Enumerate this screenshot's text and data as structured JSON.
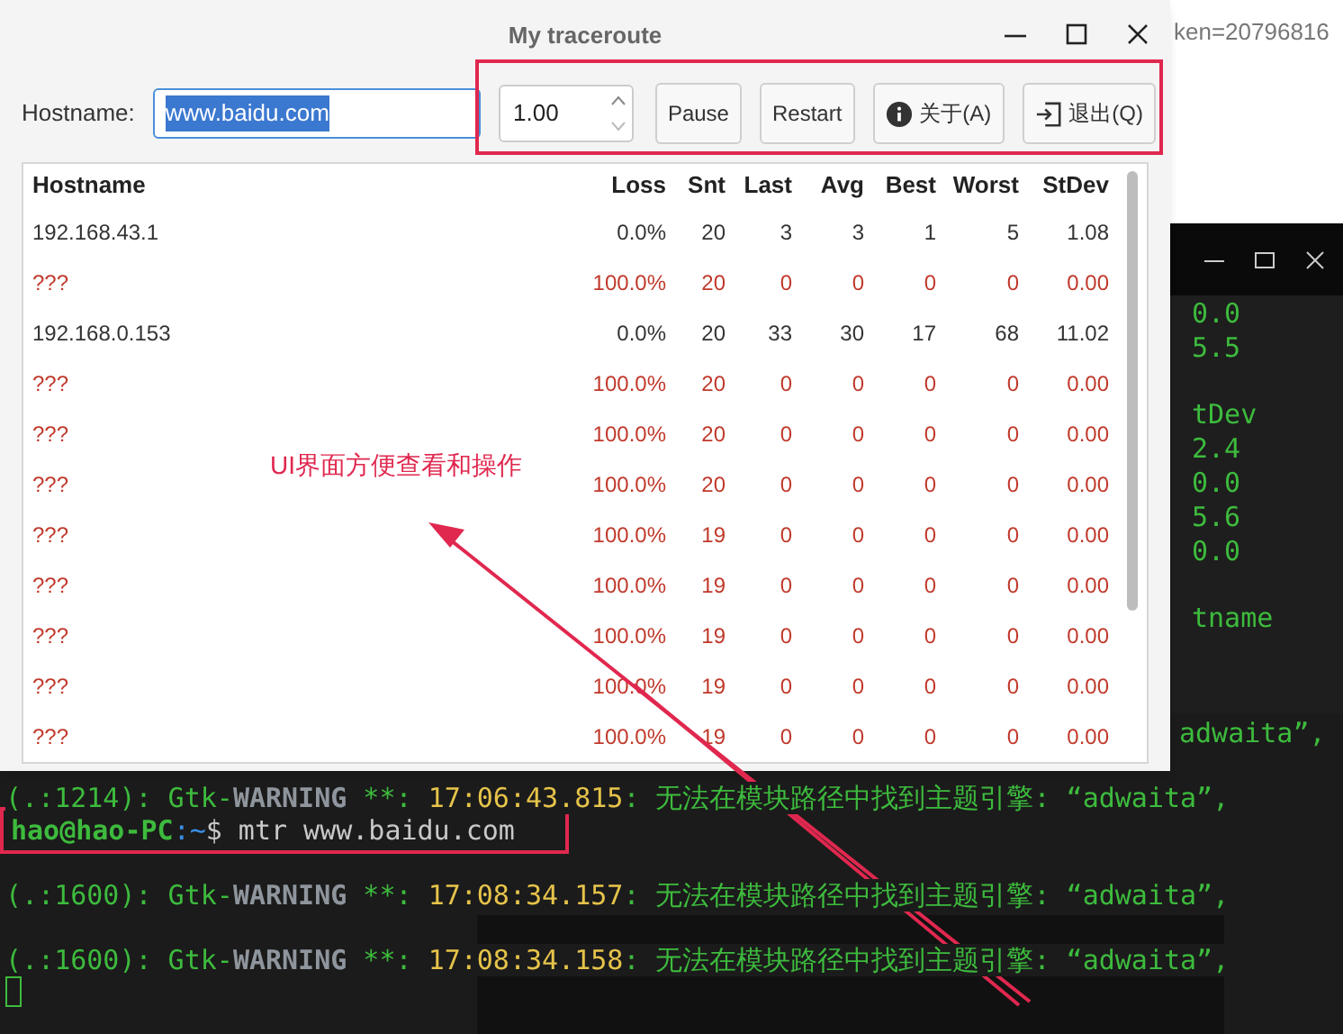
{
  "browser": {
    "url_fragment": "ken=20796816"
  },
  "terminal_right": {
    "blocks": [
      [
        "0.0",
        "5.5"
      ],
      [
        "tDev",
        "2.4",
        "0.0",
        "5.6",
        "0.0"
      ],
      [
        "tname"
      ]
    ]
  },
  "terminal": {
    "lines": [
      {
        "kind": "fragment",
        "segments": [
          {
            "kind": "message",
            "text": "adwaita”,"
          }
        ]
      },
      {
        "kind": "full",
        "segments": [
          {
            "kind": "source",
            "text": "(.:1214): Gtk-"
          },
          {
            "kind": "level",
            "text": "WARNING"
          },
          {
            "kind": "source",
            "text": " **: "
          },
          {
            "kind": "time",
            "text": "17:06:43.815"
          },
          {
            "kind": "message",
            "text": ": 无法在模块路径中找到主题引擎: “adwaita”,"
          }
        ]
      },
      {
        "kind": "full",
        "segments": [
          {
            "kind": "user",
            "text": "hao@hao-PC"
          },
          {
            "kind": "path",
            "text": ":~"
          },
          {
            "kind": "command",
            "text": "$ mtr www.baidu.com"
          }
        ]
      },
      {
        "kind": "full",
        "segments": [
          {
            "kind": "source",
            "text": "(.:1600): Gtk-"
          },
          {
            "kind": "level",
            "text": "WARNING"
          },
          {
            "kind": "source",
            "text": " **: "
          },
          {
            "kind": "time",
            "text": "17:08:34.157"
          },
          {
            "kind": "message",
            "text": ": 无法在模块路径中找到主题引擎: “adwaita”,"
          }
        ]
      },
      {
        "kind": "full",
        "segments": [
          {
            "kind": "source",
            "text": "(.:1600): Gtk-"
          },
          {
            "kind": "level",
            "text": "WARNING"
          },
          {
            "kind": "source",
            "text": " **: "
          },
          {
            "kind": "time",
            "text": "17:08:34.158"
          },
          {
            "kind": "message",
            "text": ": 无法在模块路径中找到主题引擎: “adwaita”,"
          }
        ]
      },
      {
        "kind": "cursor"
      }
    ]
  },
  "window": {
    "title": "My traceroute"
  },
  "toolbar": {
    "hostname_label": "Hostname:",
    "hostname_value": "www.baidu.com",
    "interval": "1.00",
    "buttons": [
      {
        "label": "Pause"
      },
      {
        "label": "Restart"
      },
      {
        "label": "关于(A)"
      },
      {
        "label": "退出(Q)"
      }
    ]
  },
  "table": {
    "columns": [
      "Hostname",
      "Loss",
      "Snt",
      "Last",
      "Avg",
      "Best",
      "Worst",
      "StDev"
    ],
    "rows": [
      {
        "kind": "reply",
        "cells": [
          "192.168.43.1",
          "0.0%",
          "20",
          "3",
          "3",
          "1",
          "5",
          "1.08"
        ]
      },
      {
        "kind": "timeout",
        "cells": [
          "???",
          "100.0%",
          "20",
          "0",
          "0",
          "0",
          "0",
          "0.00"
        ]
      },
      {
        "kind": "reply",
        "cells": [
          "192.168.0.153",
          "0.0%",
          "20",
          "33",
          "30",
          "17",
          "68",
          "11.02"
        ]
      },
      {
        "kind": "timeout",
        "cells": [
          "???",
          "100.0%",
          "20",
          "0",
          "0",
          "0",
          "0",
          "0.00"
        ]
      },
      {
        "kind": "timeout",
        "cells": [
          "???",
          "100.0%",
          "20",
          "0",
          "0",
          "0",
          "0",
          "0.00"
        ]
      },
      {
        "kind": "timeout",
        "cells": [
          "???",
          "100.0%",
          "20",
          "0",
          "0",
          "0",
          "0",
          "0.00"
        ]
      },
      {
        "kind": "timeout",
        "cells": [
          "???",
          "100.0%",
          "19",
          "0",
          "0",
          "0",
          "0",
          "0.00"
        ]
      },
      {
        "kind": "timeout",
        "cells": [
          "???",
          "100.0%",
          "19",
          "0",
          "0",
          "0",
          "0",
          "0.00"
        ]
      },
      {
        "kind": "timeout",
        "cells": [
          "???",
          "100.0%",
          "19",
          "0",
          "0",
          "0",
          "0",
          "0.00"
        ]
      },
      {
        "kind": "timeout",
        "cells": [
          "???",
          "100.0%",
          "19",
          "0",
          "0",
          "0",
          "0",
          "0.00"
        ]
      },
      {
        "kind": "timeout",
        "cells": [
          "???",
          "100.0%",
          "19",
          "0",
          "0",
          "0",
          "0",
          "0.00"
        ]
      }
    ]
  },
  "annotation": {
    "label": "UI界面方便查看和操作"
  }
}
